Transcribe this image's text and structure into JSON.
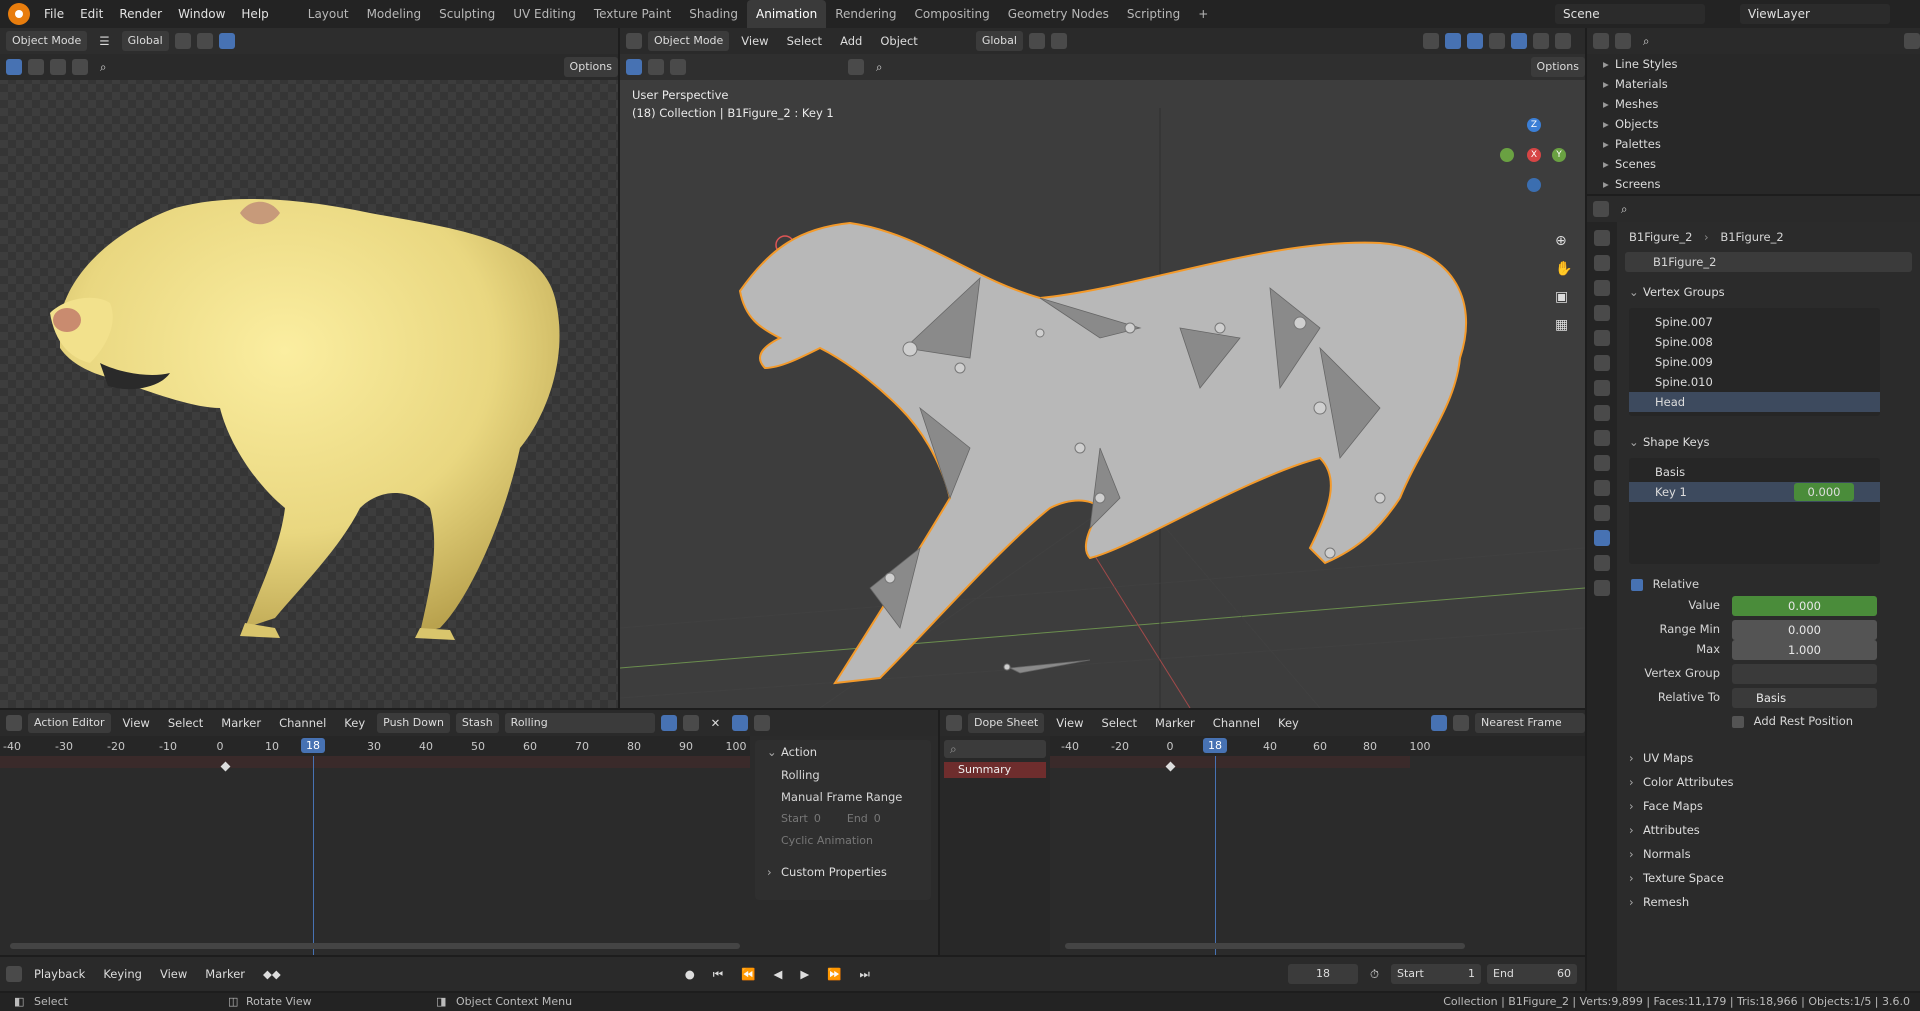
{
  "topbar": {
    "menus": [
      "File",
      "Edit",
      "Render",
      "Window",
      "Help"
    ],
    "workspaces": [
      "Layout",
      "Modeling",
      "Sculpting",
      "UV Editing",
      "Texture Paint",
      "Shading",
      "Animation",
      "Rendering",
      "Compositing",
      "Geometry Nodes",
      "Scripting"
    ],
    "active_workspace": "Animation",
    "add_tab": "+",
    "scene": "Scene",
    "view_layer": "ViewLayer"
  },
  "left_viewport": {
    "mode": "Object Mode",
    "orientation": "Global",
    "options": "Options"
  },
  "main_viewport": {
    "mode": "Object Mode",
    "menus": [
      "View",
      "Select",
      "Add",
      "Object"
    ],
    "orientation": "Global",
    "options": "Options",
    "overlay_title": "User Perspective",
    "overlay_subtitle": "(18) Collection | B1Figure_2 : Key 1"
  },
  "outliner": {
    "items": [
      "Line Styles",
      "Materials",
      "Meshes",
      "Objects",
      "Palettes",
      "Scenes",
      "Screens"
    ]
  },
  "properties": {
    "breadcrumb_object": "B1Figure_2",
    "breadcrumb_data": "B1Figure_2",
    "data_name": "B1Figure_2",
    "vertex_groups_title": "Vertex Groups",
    "vertex_groups": [
      "Spine.007",
      "Spine.008",
      "Spine.009",
      "Spine.010",
      "Head"
    ],
    "shape_keys_title": "Shape Keys",
    "shape_keys": [
      {
        "name": "Basis",
        "value": ""
      },
      {
        "name": "Key 1",
        "value": "0.000"
      }
    ],
    "relative_label": "Relative",
    "value_label": "Value",
    "value": "0.000",
    "range_min_label": "Range Min",
    "range_min": "0.000",
    "max_label": "Max",
    "max": "1.000",
    "vertex_group_label": "Vertex Group",
    "relative_to_label": "Relative To",
    "relative_to": "Basis",
    "add_rest_position": "Add Rest Position",
    "collapsed_sections": [
      "UV Maps",
      "Color Attributes",
      "Face Maps",
      "Attributes",
      "Normals",
      "Texture Space",
      "Remesh"
    ]
  },
  "action_editor": {
    "editor_type": "Action Editor",
    "menus": [
      "View",
      "Select",
      "Marker",
      "Channel",
      "Key"
    ],
    "push_down": "Push Down",
    "stash": "Stash",
    "action_name": "Rolling",
    "ticks": [
      "-40",
      "-30",
      "-20",
      "-10",
      "0",
      "10",
      "30",
      "40",
      "50",
      "60",
      "70",
      "80",
      "90",
      "100"
    ],
    "current_frame": "18",
    "panel_title": "Action",
    "panel_action_name": "Rolling",
    "manual_frame_range": "Manual Frame Range",
    "start_label": "Start",
    "start_value": "0",
    "end_label": "End",
    "end_value": "0",
    "cyclic": "Cyclic Animation",
    "custom_properties": "Custom Properties"
  },
  "dope_sheet": {
    "editor_type": "Dope Sheet",
    "menus": [
      "View",
      "Select",
      "Marker",
      "Channel",
      "Key"
    ],
    "snap": "Nearest Frame",
    "summary": "Summary",
    "ticks": [
      "-40",
      "-20",
      "0",
      "40",
      "60",
      "80",
      "100"
    ],
    "current_frame": "18"
  },
  "timeline": {
    "menus": [
      "Playback",
      "Keying",
      "View",
      "Marker"
    ],
    "current_frame": "18",
    "start_label": "Start",
    "start": "1",
    "end_label": "End",
    "end": "60"
  },
  "statusbar": {
    "select": "Select",
    "rotate": "Rotate View",
    "context_menu": "Object Context Menu",
    "stats": "Collection | B1Figure_2 | Verts:9,899 | Faces:11,179 | Tris:18,966 | Objects:1/5 | 3.6.0"
  },
  "colors": {
    "accent": "#4772b3",
    "selection_outline": "#f39a2b",
    "green_field": "#4a8c3a",
    "workspace_active": "#3a3a3a"
  }
}
